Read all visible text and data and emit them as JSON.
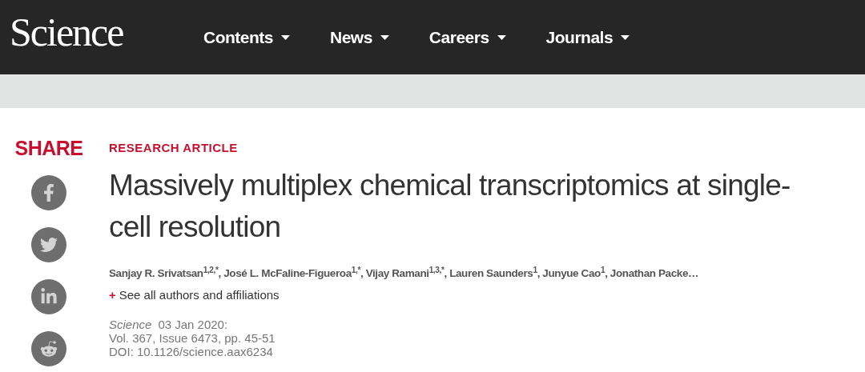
{
  "header": {
    "logo": "Science",
    "nav": [
      {
        "label": "Contents"
      },
      {
        "label": "News"
      },
      {
        "label": "Careers"
      },
      {
        "label": "Journals"
      }
    ]
  },
  "share": {
    "label": "SHARE",
    "buttons": [
      {
        "kind": "facebook"
      },
      {
        "kind": "twitter"
      },
      {
        "kind": "linkedin"
      },
      {
        "kind": "reddit"
      }
    ]
  },
  "article": {
    "type": "RESEARCH ARTICLE",
    "title": "Massively multiplex chemical transcriptomics at single-cell resolution",
    "authors": "Sanjay R. Srivatsan$^{1,2,*}$, José L. McFaline-Figueroa$^{1,*}$, Vijay Ramani$^{1,3,*}$, Lauren Saunders$^{1}$, Junyue Cao$^{1}$, Jonathan Packe…",
    "expand_sign": "+",
    "expand_link": "See all authors and affiliations",
    "journal": "Science",
    "date": "03 Jan 2020:",
    "volume": "Vol. 367, Issue 6473, pp. 45-51",
    "doi": "DOI: 10.1126/science.aax6234"
  }
}
